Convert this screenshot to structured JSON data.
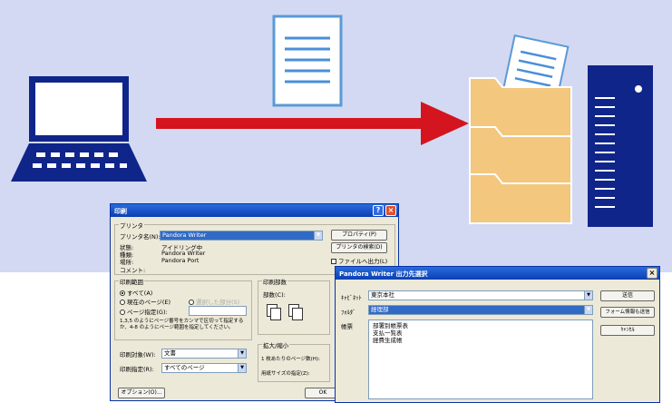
{
  "print_dialog": {
    "title": "印刷",
    "printer_group_label": "プリンタ",
    "printer_name_label": "プリンタ名(N):",
    "printer_name_value": "Pandora Writer",
    "properties_button": "プロパティ(P)",
    "find_printer_button": "プリンタの検索(D)",
    "print_to_file_label": "ファイルへ出力(L)",
    "status_label": "状態:",
    "status_value": "アイドリング中",
    "type_label": "種類:",
    "type_value": "Pandora Writer",
    "location_label": "場所:",
    "location_value": "Pandora Port",
    "comment_label": "コメント:",
    "range_group_label": "印刷範囲",
    "range_all": "すべて(A)",
    "range_current": "現在のページ(E)",
    "range_selection": "選択した部分(S)",
    "range_pages": "ページ指定(G):",
    "range_hint": "1,3,5 のようにページ番号をカンマで区切って指定するか、4-8 のようにページ範囲を指定してください。",
    "copies_group_label": "印刷部数",
    "copies_label": "部数(C):",
    "print_what_label": "印刷対象(W):",
    "print_what_value": "文書",
    "print_pages_label": "印刷指定(R):",
    "print_pages_value": "すべてのページ",
    "zoom_group_label": "拡大/縮小",
    "pages_per_sheet_label": "1 枚あたりのページ数(H):",
    "scale_paper_label": "用紙サイズの指定(Z):",
    "options_button": "オプション(O)...",
    "ok_button": "OK"
  },
  "dest_dialog": {
    "title": "Pandora Writer 出力先選択",
    "cabinet_label": "ｷｬﾋﾞﾈｯﾄ",
    "cabinet_value": "東京本社",
    "folder_label": "ﾌｫﾙﾀﾞ",
    "folder_value": "経理部",
    "binder_label": "帳票",
    "binder_items": [
      "部署別帳票表",
      "支払一覧表",
      "経費生成帳"
    ],
    "send_button": "送信",
    "form_info_button": "フォーム情報も送信",
    "cancel_button": "ｷｬﾝｾﾙ"
  }
}
